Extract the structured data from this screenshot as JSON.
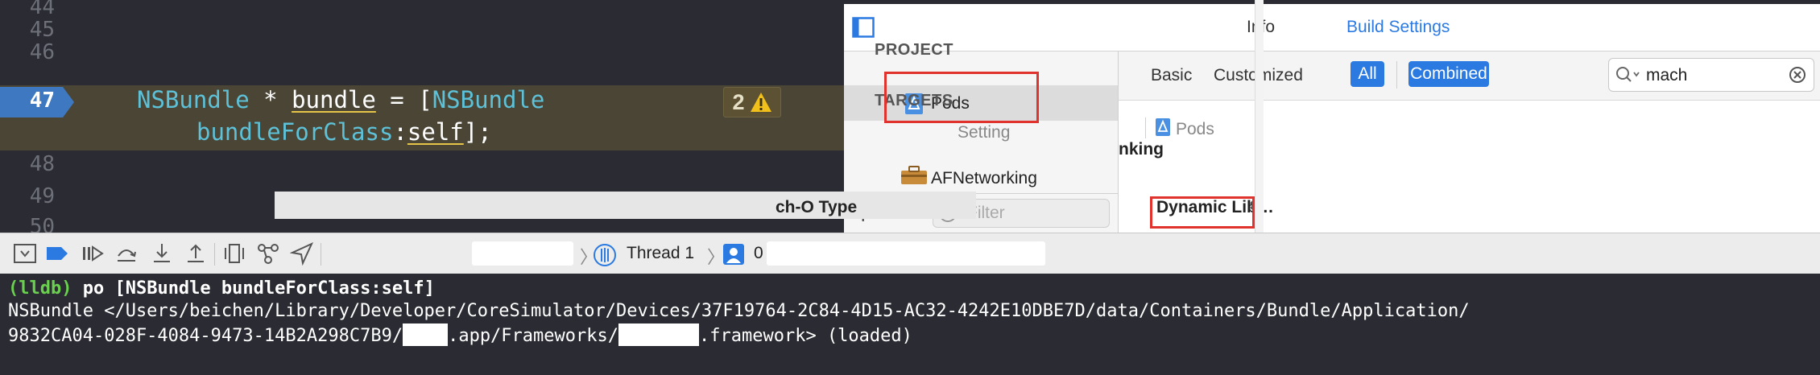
{
  "editor": {
    "line_numbers": [
      "44",
      "45",
      "46",
      "48",
      "49",
      "50"
    ],
    "current_line": "47",
    "code_line1": {
      "type1": "NSBundle",
      "plain1": " * ",
      "ident": "bundle",
      "plain2": " = [",
      "type2": "NSBundle"
    },
    "code_line2": {
      "method": "bundleForClass",
      "colon": ":",
      "self": "self",
      "end": "];"
    },
    "warning_count": "2"
  },
  "inspector": {
    "tabs": [
      "Info",
      "Build Settings"
    ],
    "active_tab": "Build Settings",
    "nav": {
      "project_heading": "PROJECT",
      "project_item": "Pods",
      "targets_heading": "TARGETS",
      "target_item": "AFNetworking",
      "filter_placeholder": "Filter"
    },
    "filter_bar": {
      "basic": "Basic",
      "customized": "Customized",
      "all": "All",
      "combined": "Combined",
      "search_value": "mach"
    },
    "section_heading": "nking",
    "columns": {
      "setting": "Setting",
      "target": "Pods"
    },
    "row": {
      "label": "ch-O Type",
      "value": "Dynamic Lib…"
    },
    "colors": {
      "accent": "#2a7ae2",
      "annotation": "#e0332e"
    }
  },
  "debug_bar": {
    "thread_label": "Thread 1",
    "frame_number": "0"
  },
  "console": {
    "prompt": "(lldb)",
    "command": " po [NSBundle bundleForClass:self]",
    "output_line1": "NSBundle </Users/beichen/Library/Developer/CoreSimulator/Devices/37F19764-2C84-4D15-AC32-4242E10DBE7D/data/Containers/Bundle/Application/",
    "output_line2_a": "9832CA04-028F-4084-9473-14B2A298C7B9/",
    "output_line2_b": ".app/Frameworks/",
    "output_line2_c": ".framework> (loaded)"
  }
}
